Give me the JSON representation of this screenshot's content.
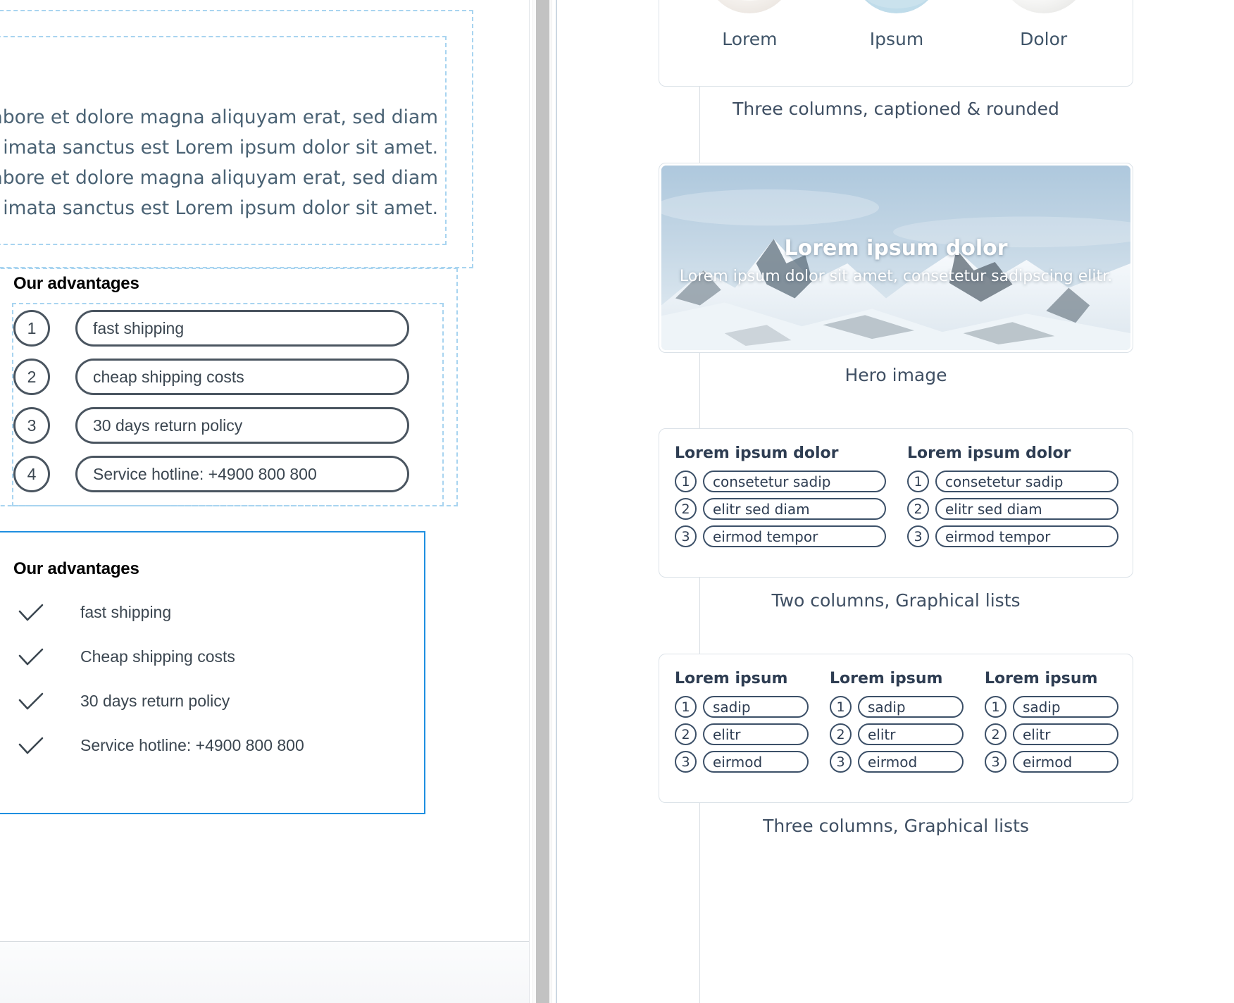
{
  "editor": {
    "text_block": {
      "lines": [
        "abore et dolore magna aliquyam erat, sed diam",
        "imata sanctus est Lorem ipsum dolor sit amet.",
        "abore et dolore magna aliquyam erat, sed diam",
        "imata sanctus est Lorem ipsum dolor sit amet."
      ]
    },
    "advantages_numbered": {
      "title": "Our advantages",
      "items": [
        {
          "number": "1",
          "label": "fast shipping"
        },
        {
          "number": "2",
          "label": "cheap shipping costs"
        },
        {
          "number": "3",
          "label": "30 days return policy"
        },
        {
          "number": "4",
          "label": "Service hotline: +4900 800 800"
        }
      ]
    },
    "advantages_checked": {
      "title": "Our advantages",
      "icon": "check-icon",
      "items": [
        {
          "label": "fast shipping"
        },
        {
          "label": "Cheap shipping costs"
        },
        {
          "label": "30 days return policy"
        },
        {
          "label": "Service hotline: +4900 800 800"
        }
      ]
    }
  },
  "preview": {
    "three_columns_captioned": {
      "caption": "Three columns, captioned & rounded",
      "columns": [
        {
          "label": "Lorem",
          "thumb": "product-thumb-cream"
        },
        {
          "label": "Ipsum",
          "thumb": "product-thumb-blue"
        },
        {
          "label": "Dolor",
          "thumb": "product-thumb-white"
        }
      ]
    },
    "hero": {
      "caption": "Hero image",
      "image": "snowy-mountain-image",
      "overlay_title": "Lorem ipsum dolor",
      "overlay_subtitle": "Lorem ipsum dolor sit amet, consetetur sadipscing elitr."
    },
    "two_columns_lists": {
      "caption": "Two columns, Graphical lists",
      "columns": [
        {
          "heading": "Lorem ipsum dolor",
          "items": [
            {
              "number": "1",
              "label": "consetetur sadip"
            },
            {
              "number": "2",
              "label": "elitr sed diam"
            },
            {
              "number": "3",
              "label": "eirmod tempor"
            }
          ]
        },
        {
          "heading": "Lorem ipsum dolor",
          "items": [
            {
              "number": "1",
              "label": "consetetur sadip"
            },
            {
              "number": "2",
              "label": "elitr sed diam"
            },
            {
              "number": "3",
              "label": "eirmod tempor"
            }
          ]
        }
      ]
    },
    "three_columns_lists": {
      "caption": "Three columns, Graphical lists",
      "columns": [
        {
          "heading": "Lorem ipsum",
          "items": [
            {
              "number": "1",
              "label": "sadip"
            },
            {
              "number": "2",
              "label": "elitr"
            },
            {
              "number": "3",
              "label": "eirmod"
            }
          ]
        },
        {
          "heading": "Lorem ipsum",
          "items": [
            {
              "number": "1",
              "label": "sadip"
            },
            {
              "number": "2",
              "label": "elitr"
            },
            {
              "number": "3",
              "label": "eirmod"
            }
          ]
        },
        {
          "heading": "Lorem ipsum",
          "items": [
            {
              "number": "1",
              "label": "sadip"
            },
            {
              "number": "2",
              "label": "elitr"
            },
            {
              "number": "3",
              "label": "eirmod"
            }
          ]
        }
      ]
    }
  },
  "colors": {
    "selection_blue": "#1f8fe0",
    "dashed_blue": "#a8d4f0",
    "outline_dark": "#4a5560",
    "preview_text": "#2e3d52",
    "body_text": "#4a6274"
  }
}
